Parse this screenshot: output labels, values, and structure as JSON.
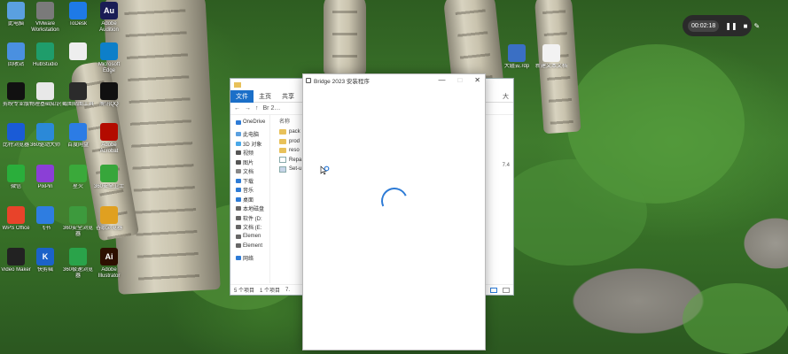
{
  "desktop_icons": [
    {
      "label": "此电脑",
      "icon": "computer-icon",
      "color": "#5aa0e0"
    },
    {
      "label": "VMware Workstation",
      "icon": "vmware-icon",
      "color": "#7a7a7a"
    },
    {
      "label": "ToDesk",
      "icon": "todesk-icon",
      "color": "#1e7ae6"
    },
    {
      "label": "Adobe Audition",
      "icon": "audition-icon",
      "color": "#1a1d55",
      "text": "Au"
    },
    {
      "label": "回收站",
      "icon": "recycle-bin-icon",
      "color": "#4a90e0"
    },
    {
      "label": "HubStudio",
      "icon": "hubstudio-icon",
      "color": "#1f9d6b"
    },
    {
      "label": "",
      "icon": "blank-file-icon",
      "color": "#eeeeee"
    },
    {
      "label": "Microsoft Edge",
      "icon": "edge-icon",
      "color": "#0d7fc9"
    },
    {
      "label": "剪映专业版",
      "icon": "capcut-icon",
      "color": "#111111"
    },
    {
      "label": "物理基础知识",
      "icon": "document-icon",
      "color": "#e8e8e8"
    },
    {
      "label": "截图贴图工具",
      "icon": "snip-icon",
      "color": "#2b2b2b"
    },
    {
      "label": "腾讯QQ",
      "icon": "qq-icon",
      "color": "#101010"
    },
    {
      "label": "比特浏览器",
      "icon": "bitbrowser-icon",
      "color": "#1a5bd6"
    },
    {
      "label": "360驱动大师",
      "icon": "driver-icon",
      "color": "#2b89d8"
    },
    {
      "label": "百度网盘",
      "icon": "baidu-netdisk-icon",
      "color": "#2c7ce5"
    },
    {
      "label": "Adobe Acrobat",
      "icon": "acrobat-icon",
      "color": "#b30b00"
    },
    {
      "label": "微信",
      "icon": "wechat-icon",
      "color": "#2aae3b"
    },
    {
      "label": "PixPin",
      "icon": "pixpin-icon",
      "color": "#8b3fd6"
    },
    {
      "label": "星火",
      "icon": "spark-icon",
      "color": "#3aa93a"
    },
    {
      "label": "360安全卫士",
      "icon": "security-guard-icon",
      "color": "#37a63b"
    },
    {
      "label": "WPS Office",
      "icon": "wps-icon",
      "color": "#e8432a"
    },
    {
      "label": "飞书",
      "icon": "feishu-icon",
      "color": "#2e7de1"
    },
    {
      "label": "360安全浏览器",
      "icon": "secure-browser-icon",
      "color": "#3d9a3d"
    },
    {
      "label": "谷歌浏览器",
      "icon": "chrome-icon",
      "color": "#e0a020"
    },
    {
      "label": "Video Maker",
      "icon": "video-icon",
      "color": "#222222"
    },
    {
      "label": "快剪辑",
      "icon": "kuaijianji-icon",
      "color": "#1b62c8",
      "text": "K"
    },
    {
      "label": "360极速浏览器",
      "icon": "speed-browser-icon",
      "color": "#2aa34a"
    },
    {
      "label": "Adobe Illustrator",
      "icon": "illustrator-icon",
      "color": "#2d0f00",
      "text": "Ai"
    }
  ],
  "right_icons": [
    {
      "label": "大疆云.rdp",
      "icon": "rdp-icon",
      "color": "#3a6fc4"
    },
    {
      "label": "新建文本文档",
      "icon": "text-document-icon",
      "color": "#f2f2f2"
    }
  ],
  "recording": {
    "time": "00:02:18"
  },
  "explorer": {
    "path": "Br 2…",
    "ribbon_tabs": [
      "文件",
      "主页",
      "共享"
    ],
    "nav_items": [
      {
        "label": "OneDrive",
        "icon": "onedrive-icon",
        "color": "#2d7bd6"
      },
      {
        "label": "此电脑",
        "icon": "pc-icon",
        "color": "#5aa0e0"
      },
      {
        "label": "3D 对象",
        "icon": "3d-objects-icon",
        "color": "#4aa8e8"
      },
      {
        "label": "视频",
        "icon": "videos-icon",
        "color": "#555"
      },
      {
        "label": "图片",
        "icon": "pictures-icon",
        "color": "#555"
      },
      {
        "label": "文档",
        "icon": "documents-icon",
        "color": "#888"
      },
      {
        "label": "下载",
        "icon": "downloads-icon",
        "color": "#2d7bd6"
      },
      {
        "label": "音乐",
        "icon": "music-icon",
        "color": "#2d7bd6"
      },
      {
        "label": "桌面",
        "icon": "desktop-icon",
        "color": "#2d7bd6"
      },
      {
        "label": "本地磁盘",
        "icon": "drive-c-icon",
        "color": "#666"
      },
      {
        "label": "软件 (D:",
        "icon": "drive-d-icon",
        "color": "#666"
      },
      {
        "label": "文档 (E:",
        "icon": "drive-e-icon",
        "color": "#666"
      },
      {
        "label": "Elemen",
        "icon": "drive-icon",
        "color": "#666"
      },
      {
        "label": "Element",
        "icon": "drive-icon",
        "color": "#666"
      },
      {
        "label": "网络",
        "icon": "network-icon",
        "color": "#2d7bd6"
      }
    ],
    "column_header": "名称",
    "files": [
      {
        "name": "pack",
        "type": "folder"
      },
      {
        "name": "prod",
        "type": "folder"
      },
      {
        "name": "reso",
        "type": "folder"
      },
      {
        "name": "Repa",
        "type": "file"
      },
      {
        "name": "Set-u",
        "type": "exe"
      }
    ],
    "status": {
      "count": "5 个项目",
      "selected": "1 个项目",
      "extra": "7."
    },
    "right_col": {
      "size_header": "大",
      "size_value": "7.4"
    }
  },
  "installer": {
    "title": "Bridge 2023 安装程序",
    "min": "—",
    "max": "□",
    "close": "✕"
  }
}
